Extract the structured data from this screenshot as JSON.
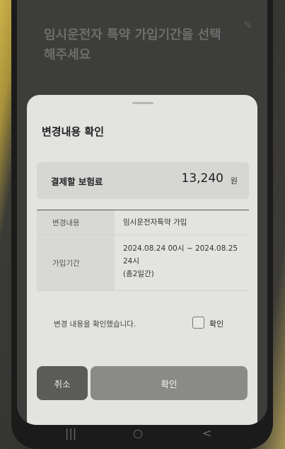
{
  "background": {
    "heading": "임시운전자 특약 가입기간을 선택해주세요",
    "edit_icon": "pencil-icon"
  },
  "sheet": {
    "title": "변경내용 확인",
    "premium": {
      "label": "결제할 보험료",
      "amount": "13,240",
      "unit": "원"
    },
    "details": [
      {
        "label": "변경내용",
        "value": "임시운전자특약 가입"
      },
      {
        "label": "가입기간",
        "value_lines": [
          "2024.08.24 00시 ~ 2024.08.25",
          "24시",
          "(총2일간)"
        ]
      }
    ],
    "confirm_text": "변경 내용을 확인했습니다.",
    "checkbox_label": "확인",
    "checkbox_checked": false,
    "cancel_label": "취소",
    "confirm_label": "확인"
  },
  "navbar": {
    "recents_glyph": "|||",
    "home_glyph": "○",
    "back_glyph": "<",
    "icons": [
      "recent-apps-icon",
      "home-icon",
      "back-icon"
    ]
  },
  "colors": {
    "sheet_bg": "#e3e3e1",
    "cancel_bg": "#5b5b5a",
    "confirm_bg": "#8a8a89",
    "overlay": "#3d3d3c"
  }
}
